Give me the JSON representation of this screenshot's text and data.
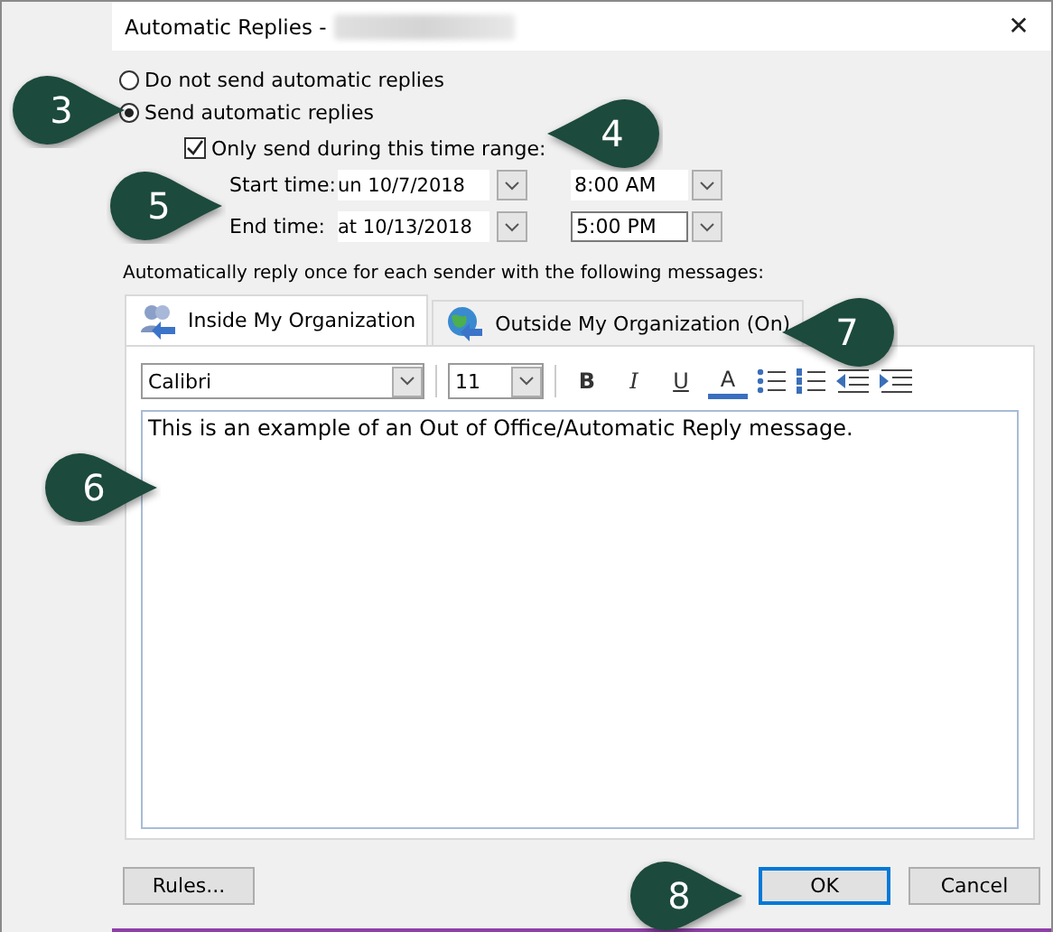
{
  "window": {
    "title": "Automatic Replies -",
    "close": "✕"
  },
  "options": [
    {
      "label": "Do not send automatic replies",
      "selected": false
    },
    {
      "label": "Send automatic replies",
      "selected": true
    }
  ],
  "time_range": {
    "label": "Only send during this time range:",
    "checked": true
  },
  "times": [
    {
      "label": "Start time:",
      "date": "un 10/7/2018",
      "time": "8:00 AM"
    },
    {
      "label": "End time:",
      "date": "at 10/13/2018",
      "time": "5:00 PM"
    }
  ],
  "instructions": "Automatically reply once for each sender with the following messages:",
  "tabs": [
    {
      "label": "Inside My Organization",
      "selected": true,
      "kind": "inside"
    },
    {
      "label": "Outside My Organization (On)",
      "selected": false,
      "kind": "outside"
    }
  ],
  "toolbar": {
    "font": "Calibri",
    "size": "11",
    "format_buttons": [
      {
        "label": "B",
        "kind": "bold"
      },
      {
        "label": "I",
        "kind": "italic"
      },
      {
        "label": "U",
        "kind": "underline"
      },
      {
        "label": "A",
        "kind": "color"
      }
    ]
  },
  "message": "This is an example of an Out of Office/Automatic Reply message.",
  "buttons": [
    {
      "label": "Rules...",
      "selected": false
    },
    {
      "label": "OK",
      "selected": true
    },
    {
      "label": "Cancel",
      "selected": false
    }
  ],
  "callouts": [
    {
      "number": "3"
    },
    {
      "number": "4"
    },
    {
      "number": "5"
    },
    {
      "number": "6"
    },
    {
      "number": "7"
    },
    {
      "number": "8"
    }
  ]
}
